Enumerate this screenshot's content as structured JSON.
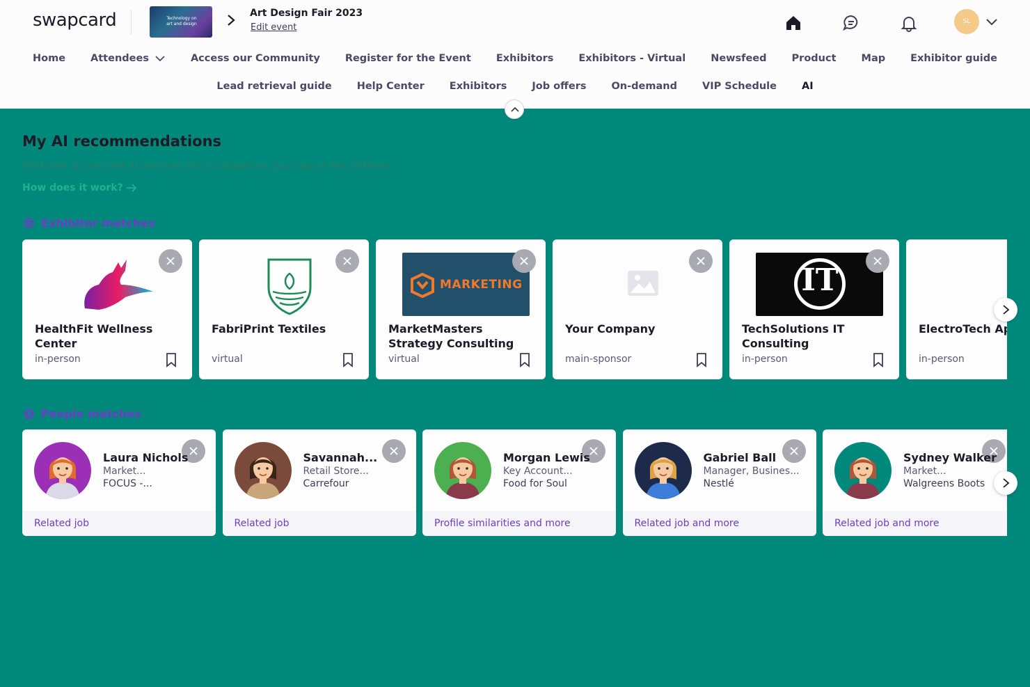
{
  "brand": {
    "logo_text": "swapcard"
  },
  "event": {
    "title": "Art Design Fair 2023",
    "edit_label": "Edit event",
    "thumb_text": "Technology on art and design"
  },
  "user": {
    "initials": "SL"
  },
  "nav": {
    "row1": [
      {
        "label": "Home"
      },
      {
        "label": "Attendees",
        "dropdown": true
      },
      {
        "label": "Access our Community"
      },
      {
        "label": "Register for the Event"
      },
      {
        "label": "Exhibitors"
      },
      {
        "label": "Exhibitors - Virtual"
      },
      {
        "label": "Newsfeed"
      },
      {
        "label": "Product"
      },
      {
        "label": "Map"
      },
      {
        "label": "Exhibitor guide"
      }
    ],
    "row2": [
      {
        "label": "Lead retrieval guide"
      },
      {
        "label": "Help Center"
      },
      {
        "label": "Exhibitors"
      },
      {
        "label": "Job offers"
      },
      {
        "label": "On-demand"
      },
      {
        "label": "VIP Schedule"
      },
      {
        "label": "AI",
        "active": true
      }
    ]
  },
  "main": {
    "title": "My AI recommendations",
    "description": "Find here all our best AI matches for you based on your use of the platform.",
    "how_link": "How does it work?",
    "exhibitor_section": "Exhibitor matches",
    "people_section": "People matches"
  },
  "exhibitors": [
    {
      "name": "HealthFit Wellness Center",
      "type": "in-person",
      "logo": "deer-logo"
    },
    {
      "name": "FabriPrint Textiles",
      "type": "virtual",
      "logo": "shield-leaf-logo"
    },
    {
      "name": "MarketMasters Strategy Consulting",
      "type": "virtual",
      "logo": "marketing-logo",
      "logo_text": "MARKETING"
    },
    {
      "name": "Your Company",
      "type": "main-sponsor",
      "logo": "placeholder-image"
    },
    {
      "name": "TechSolutions IT Consulting",
      "type": "in-person",
      "logo": "it-logo",
      "logo_text": "IT"
    },
    {
      "name": "ElectroTech Ap",
      "type": "in-person",
      "logo": "swirl-logo"
    }
  ],
  "people": [
    {
      "name": "Laura Nichols",
      "role": "Market...",
      "company": "FOCUS -...",
      "reason": "Related job",
      "avatar_bg": "#9b2fb5",
      "hair": "#e06b2d",
      "shirt": "#d9d9e8"
    },
    {
      "name": "Savannah...",
      "role": "Retail Store...",
      "company": "Carrefour",
      "reason": "Related job",
      "avatar_bg": "#7a4a3a",
      "hair": "#3a2418",
      "shirt": "#c9a57a"
    },
    {
      "name": "Morgan Lewis",
      "role": "Key Account...",
      "company": "Food for Soul",
      "reason": "Profile similarities and more",
      "avatar_bg": "#4caf50",
      "hair": "#b0573a",
      "shirt": "#8a3a4a"
    },
    {
      "name": "Gabriel Ball",
      "role": "Manager, Busines...",
      "company": "Nestlé",
      "reason": "Related job and more",
      "avatar_bg": "#1d2a4a",
      "hair": "#d9a441",
      "shirt": "#3b7dd8"
    },
    {
      "name": "Sydney Walker",
      "role": "Market...",
      "company": "Walgreens Boots",
      "reason": "Related job and more",
      "avatar_bg": "#00897B",
      "hair": "#b0573a",
      "shirt": "#8a3a4a"
    }
  ],
  "colors": {
    "page_bg": "#00897B",
    "accent_purple": "#6a3ec6",
    "link_green": "#1fb28c"
  },
  "icons": {
    "home": "home-icon",
    "chat": "chat-icon",
    "bell": "bell-icon"
  }
}
